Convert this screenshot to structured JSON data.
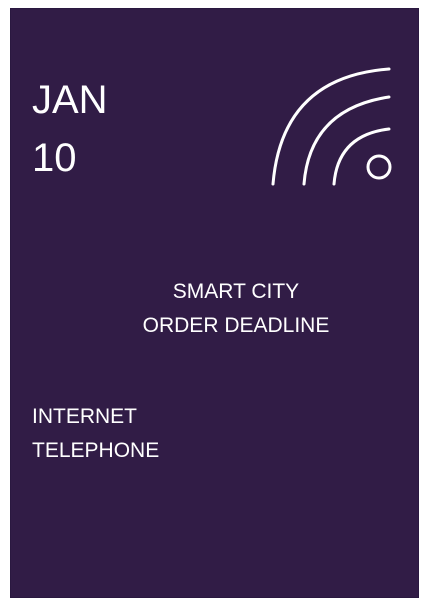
{
  "card": {
    "month": "JAN",
    "day": "10",
    "signal_icon": "wireless-signal-icon",
    "event_lines": [
      "SMART CITY",
      "ORDER DEADLINE"
    ],
    "service_lines": [
      "INTERNET",
      "TELEPHONE"
    ],
    "colors": {
      "background": "#311c46",
      "text": "#ffffff"
    }
  }
}
